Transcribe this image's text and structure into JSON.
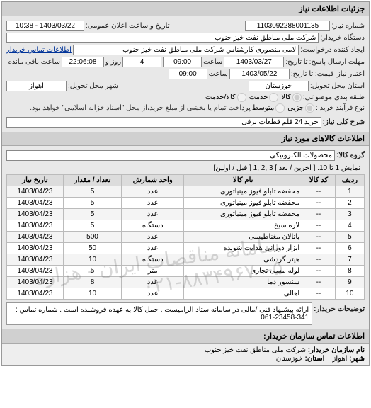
{
  "header": {
    "title": "جزئیات اطلاعات نیاز"
  },
  "general": {
    "need_no_label": "شماره نیاز:",
    "need_no": "1103092288001135",
    "announce_label": "تاریخ و ساعت اعلان عمومی:",
    "announce_value": "1403/03/22 - 10:38",
    "buyer_org_label": "دستگاه خریدار:",
    "buyer_org": "شرکت ملی مناطق نفت خیز جنوب",
    "requester_label": "ایجاد کننده درخواست:",
    "requester": "لامی منصوری کارشناس شرکت ملی مناطق نفت خیز جنوب",
    "buyer_contact_label": "اطلاعات تماس خریدار",
    "deadline_send_label": "مهلت ارسال پاسخ:",
    "date_label": "تا تاریخ:",
    "deadline_date": "1403/03/27",
    "time_label": "ساعت",
    "deadline_time": "09:00",
    "days_label": "روز و",
    "days_remain": "4",
    "remain_label": "ساعت باقی مانده",
    "remain_time": "22:06:08",
    "validity_label": "اعتبار نیاز:",
    "validity_to_label": "قیمت: تا تاریخ:",
    "validity_date": "1403/05/22",
    "validity_time": "09:00",
    "delivery_state_label": "استان محل تحویل:",
    "delivery_state": "خوزستان",
    "delivery_city_label": "شهر محل تحویل:",
    "delivery_city": "اهواز",
    "category_label": "طبقه بندی موضوعی:",
    "cat_goods": "کالا",
    "cat_service": "خدمت",
    "cat_goods_service": "کالا/خدمت",
    "process_label": "نوع فرآیند خرید :",
    "proc_minor": "جزیی",
    "proc_medium": "متوسط",
    "process_note": "پرداخت تمام یا بخشی از مبلغ خرید،از محل \"اسناد خزانه اسلامی\" خواهد بود.",
    "subject_label": "شرح کلی نیاز:",
    "subject": "خرید 24 قلم قطعات برقی"
  },
  "items_section": {
    "title": "اطلاعات کالاهای مورد نیاز",
    "group_label": "گروه کالا:",
    "group_value": "محصولات الکترونیکی",
    "pager_prefix": "نمایش 1 تا 10.",
    "pager_links": "[ آخرین / بعد ] 3 ,2 ,1 [ قبل / اولین]",
    "columns": {
      "row": "ردیف",
      "code": "کد کالا",
      "name": "نام کالا",
      "unit": "واحد شمارش",
      "qty": "تعداد / مقدار",
      "date": "تاریخ نیاز"
    },
    "rows": [
      {
        "n": "1",
        "code": "--",
        "name": "محفضه تابلو فیوز مینیاتوری",
        "unit": "عدد",
        "qty": "5",
        "date": "1403/04/23"
      },
      {
        "n": "2",
        "code": "--",
        "name": "محفضه تابلو فیوز مینیاتوری",
        "unit": "عدد",
        "qty": "5",
        "date": "1403/04/23"
      },
      {
        "n": "3",
        "code": "--",
        "name": "محفضه تابلو فیوز مینیاتوری",
        "unit": "عدد",
        "qty": "5",
        "date": "1403/04/23"
      },
      {
        "n": "4",
        "code": "--",
        "name": "لاره سیخ",
        "unit": "دستگاه",
        "qty": "5",
        "date": "1403/04/23"
      },
      {
        "n": "5",
        "code": "--",
        "name": "باتالان مغناطیسی",
        "unit": "عدد",
        "qty": "500",
        "date": "1403/04/23"
      },
      {
        "n": "6",
        "code": "--",
        "name": "ابزار دورانی هدایت شونده",
        "unit": "عدد",
        "qty": "50",
        "date": "1403/04/23"
      },
      {
        "n": "7",
        "code": "--",
        "name": "هیتر گردشی",
        "unit": "دستگاه",
        "qty": "10",
        "date": "1403/04/23"
      },
      {
        "n": "8",
        "code": "--",
        "name": "لوله مسی تجاری",
        "unit": "متر",
        "qty": "5",
        "date": "1403/04/23"
      },
      {
        "n": "9",
        "code": "--",
        "name": "سنسور دما",
        "unit": "عدد",
        "qty": "8",
        "date": "1403/04/23"
      },
      {
        "n": "10",
        "code": "--",
        "name": "اهالی",
        "unit": "عدد",
        "qty": "10",
        "date": "1403/04/23"
      }
    ]
  },
  "description": {
    "label": "توضیحات خریدار:",
    "value": "ارائه پیشنهاد فنی /مالی در سامانه ستاد الزامیست . حمل کالا به عهده فروشنده است . شماره تماس : 341-23458-061"
  },
  "org_contact": {
    "title": "اطلاعات تماس سازمان خریدار:",
    "org_label": "نام سازمان خریدار:",
    "org_value": "شرکت ملی مناطق نفت خیز جنوب",
    "city_label": "شهر:",
    "city_value": "اهواز",
    "state_label": "استان:",
    "state_value": "خوزستان"
  },
  "watermark": {
    "line1": "سامانه مناقصات ایران - هزاره",
    "line2": "۰۲۱-۸۸۳۴۹۶۷۰-۵"
  }
}
